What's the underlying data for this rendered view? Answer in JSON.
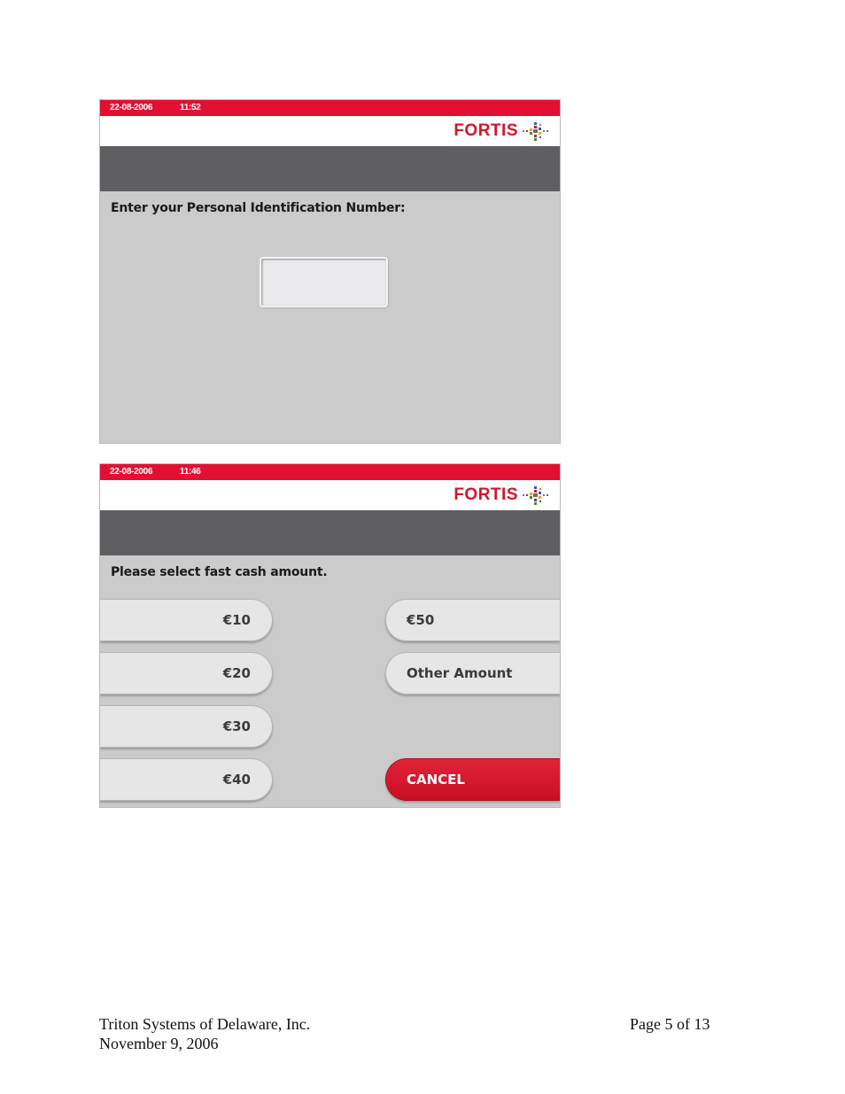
{
  "screen_pin": {
    "date": "22-08-2006",
    "time": "11:52",
    "brand": "FORTIS",
    "prompt": "Enter your Personal Identification Number:",
    "pin_value": ""
  },
  "screen_fastcash": {
    "date": "22-08-2006",
    "time": "11:46",
    "brand": "FORTIS",
    "prompt": "Please select fast cash amount.",
    "left_buttons": [
      "€10",
      "€20",
      "€30",
      "€40"
    ],
    "right_buttons": [
      "€50",
      "Other Amount"
    ],
    "cancel_label": "CANCEL"
  },
  "footer": {
    "company": "Triton Systems of Delaware, Inc.",
    "date": "November 9, 2006",
    "page": "Page 5 of 13"
  },
  "colors": {
    "brand_red": "#e30f32",
    "header_gray": "#5f5e60",
    "screen_bg": "#cbcbcb"
  }
}
